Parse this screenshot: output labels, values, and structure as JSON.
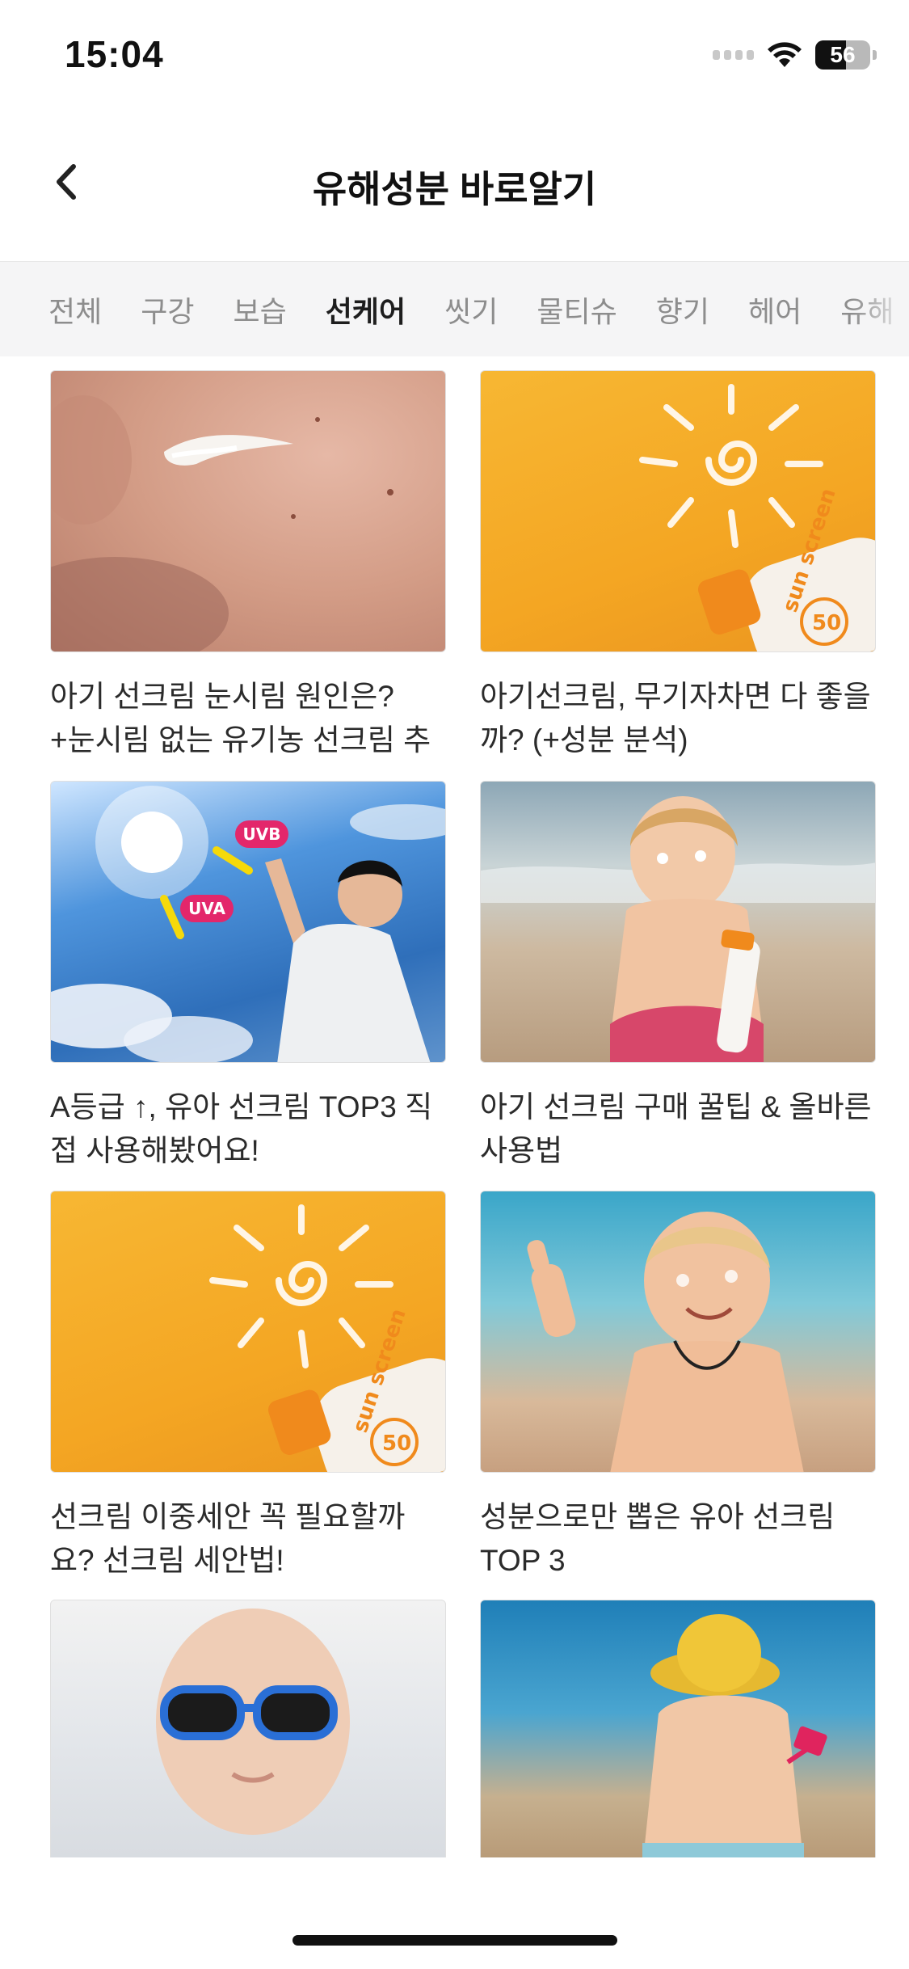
{
  "status_bar": {
    "time": "15:04",
    "battery_percent": "56",
    "battery_level": 0.56
  },
  "header": {
    "title": "유해성분 바로알기",
    "back_icon": "chevron-left-icon"
  },
  "tabs": [
    {
      "label": "전체",
      "active": false
    },
    {
      "label": "구강",
      "active": false
    },
    {
      "label": "보습",
      "active": false
    },
    {
      "label": "선케어",
      "active": true
    },
    {
      "label": "씻기",
      "active": false
    },
    {
      "label": "물티슈",
      "active": false
    },
    {
      "label": "향기",
      "active": false
    },
    {
      "label": "헤어",
      "active": false
    },
    {
      "label": "유해",
      "active": false
    }
  ],
  "cards": [
    {
      "title": "아기 선크림 눈시림 원인은? +눈시림 없는 유기농 선크림 추천"
    },
    {
      "title": "아기선크림, 무기자차면 다 좋을까? (+성분 분석)"
    },
    {
      "title": "A등급 ↑, 유아 선크림 TOP3 직접 사용해봤어요!"
    },
    {
      "title": "아기 선크림 구매 꿀팁 & 올바른 사용법"
    },
    {
      "title": "선크림 이중세안 꼭 필요할까요? 선크림 세안법!"
    },
    {
      "title": "성분으로만 뽑은 유아 선크림 TOP 3"
    },
    {
      "title": ""
    },
    {
      "title": ""
    }
  ],
  "image_labels": {
    "uvb": "UVB",
    "uva": "UVA",
    "bottle_text": "sun screen",
    "spf": "50"
  }
}
